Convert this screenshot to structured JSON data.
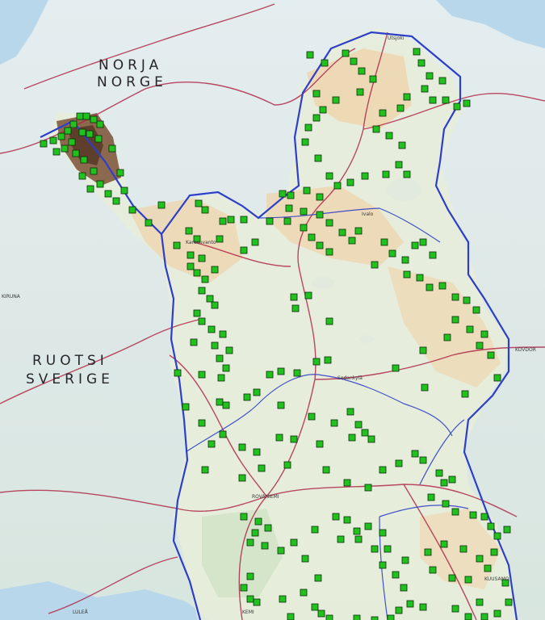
{
  "map": {
    "labels": {
      "norway_fi": "NORJA",
      "norway_no": "NORGE",
      "sweden_fi": "RUOTSI",
      "sweden_sv": "SVERIGE"
    },
    "cities": {
      "rovaniemi": "ROVANIEMI",
      "kemi": "KEMI",
      "kiruna": "KIRUNA",
      "lulea": "LULEÅ",
      "sodankyla": "Sodankylä",
      "kuusamo": "KUUSAMO",
      "karesuvanto": "Karesuvanto",
      "utsjoki": "Utsjoki",
      "ivalo": "Ivalo",
      "kovdor": "KOVDOR"
    },
    "colors": {
      "marker": "#22c21e",
      "border": "#2d3fc8",
      "road": "#b02a4a",
      "water": "#b9d7ea",
      "upland": "#f0d2a8",
      "fell": "#7a5035"
    }
  }
}
